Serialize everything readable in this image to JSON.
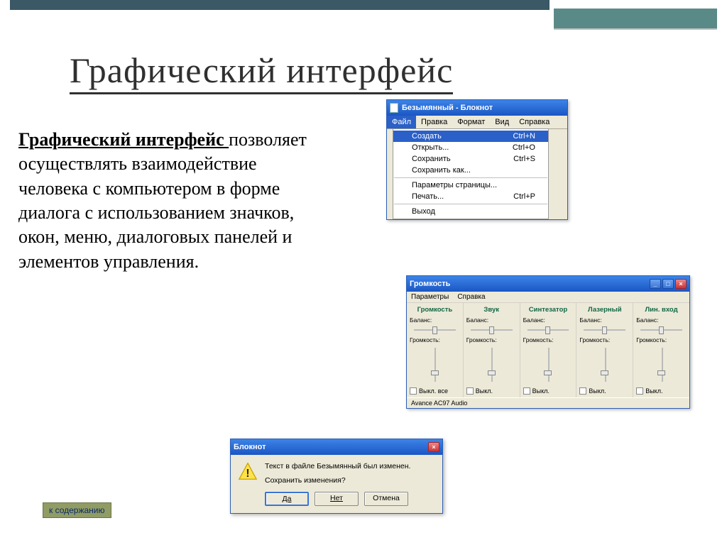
{
  "slide": {
    "title": "Графический интерфейс",
    "body_bold": "Графический интерфейс ",
    "body_rest": "позволяет осуществлять взаимодействие человека с компьютером в форме диалога с использованием значков, окон, меню, диалоговых панелей и элементов управления.",
    "toc_link": "к содержанию"
  },
  "notepad": {
    "title": "Безымянный - Блокнот",
    "menus": [
      "Файл",
      "Правка",
      "Формат",
      "Вид",
      "Справка"
    ],
    "items": [
      {
        "label": "Создать",
        "shortcut": "Ctrl+N",
        "hi": true
      },
      {
        "label": "Открыть...",
        "shortcut": "Ctrl+O"
      },
      {
        "label": "Сохранить",
        "shortcut": "Ctrl+S"
      },
      {
        "label": "Сохранить как...",
        "shortcut": ""
      },
      {
        "sep": true
      },
      {
        "label": "Параметры страницы...",
        "shortcut": ""
      },
      {
        "label": "Печать...",
        "shortcut": "Ctrl+P"
      },
      {
        "sep": true
      },
      {
        "label": "Выход",
        "shortcut": ""
      }
    ]
  },
  "volume": {
    "title": "Громкость",
    "menus": [
      "Параметры",
      "Справка"
    ],
    "columns": [
      "Громкость",
      "Звук",
      "Синтезатор",
      "Лазерный",
      "Лин. вход"
    ],
    "balance_label": "Баланс:",
    "volume_label": "Громкость:",
    "mute_main": "Выкл. все",
    "mute": "Выкл.",
    "status": "Avance AC97 Audio"
  },
  "dialog": {
    "title": "Блокнот",
    "line1": "Текст в файле Безымянный был изменен.",
    "line2": "Сохранить изменения?",
    "yes": "Да",
    "no": "Нет",
    "cancel": "Отмена"
  }
}
